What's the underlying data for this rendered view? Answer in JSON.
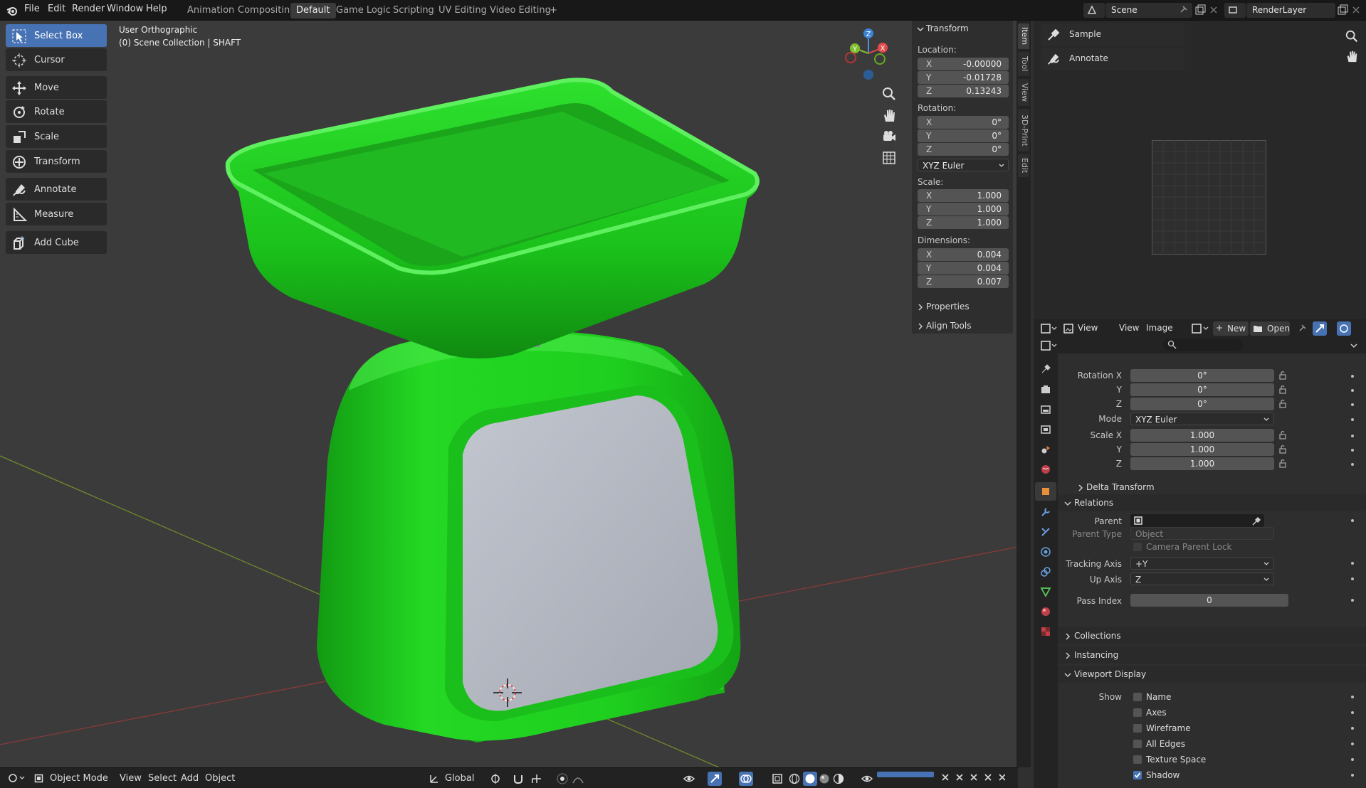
{
  "topbar": {
    "menus": [
      "File",
      "Edit",
      "Render",
      "Window",
      "Help"
    ],
    "workspaces": [
      "Animation",
      "Compositing",
      "Default",
      "Game Logic",
      "Scripting",
      "UV Editing",
      "Video Editing"
    ],
    "active_workspace": "Default",
    "add_tab": "+",
    "scene": "Scene",
    "view_layer": "RenderLayer"
  },
  "viewport": {
    "title": "User Orthographic",
    "subtitle": "(0) Scene Collection | SHAFT",
    "model_color": "#1fd41f"
  },
  "toolbar": {
    "tools": [
      "Select Box",
      "Cursor",
      "Move",
      "Rotate",
      "Scale",
      "Transform",
      "Annotate",
      "Measure",
      "Add Cube"
    ]
  },
  "gizmo": {
    "z": "Z",
    "y": "Y",
    "x": "X"
  },
  "npanel": {
    "header": "Transform",
    "location_label": "Location:",
    "location": {
      "x": "-0.00000",
      "y": "-0.01728",
      "z": "0.13243"
    },
    "rotation_label": "Rotation:",
    "rotation": {
      "x": "0°",
      "y": "0°",
      "z": "0°"
    },
    "rotation_mode": "XYZ Euler",
    "scale_label": "Scale:",
    "scale": {
      "x": "1.000",
      "y": "1.000",
      "z": "1.000"
    },
    "dimensions_label": "Dimensions:",
    "dimensions": {
      "x": "0.004",
      "y": "0.004",
      "z": "0.007"
    },
    "axis": {
      "x": "X",
      "y": "Y",
      "z": "Z"
    },
    "properties": "Properties",
    "align_tools": "Align Tools"
  },
  "sidebar_tabs": [
    "Item",
    "Tool",
    "View",
    "3D-Print",
    "Edit"
  ],
  "viewport_footer": {
    "mode": "Object Mode",
    "menus": [
      "View",
      "Select",
      "Add",
      "Object"
    ],
    "orientation": "Global"
  },
  "image_editor": {
    "tools": [
      "Sample",
      "Annotate"
    ],
    "header": {
      "view": "View",
      "menu_view": "View",
      "image": "Image",
      "new": "New",
      "open": "Open"
    }
  },
  "properties": {
    "rotation_x_label": "Rotation X",
    "rotation": {
      "x": "0°",
      "y": "0°",
      "z": "0°"
    },
    "y_label": "Y",
    "z_label": "Z",
    "mode_label": "Mode",
    "mode": "XYZ Euler",
    "scale_x_label": "Scale X",
    "scale": {
      "x": "1.000",
      "y": "1.000",
      "z": "1.000"
    },
    "delta_transform": "Delta Transform",
    "relations": "Relations",
    "parent_label": "Parent",
    "parent_type_label": "Parent Type",
    "parent_type": "Object",
    "camera_parent_lock": "Camera Parent Lock",
    "tracking_axis_label": "Tracking Axis",
    "tracking_axis": "+Y",
    "up_axis_label": "Up Axis",
    "up_axis": "Z",
    "pass_index_label": "Pass Index",
    "pass_index": "0",
    "collections": "Collections",
    "instancing": "Instancing",
    "viewport_display": "Viewport Display",
    "show_label": "Show",
    "show": [
      {
        "label": "Name",
        "checked": false
      },
      {
        "label": "Axes",
        "checked": false
      },
      {
        "label": "Wireframe",
        "checked": false
      },
      {
        "label": "All Edges",
        "checked": false
      },
      {
        "label": "Texture Space",
        "checked": false
      },
      {
        "label": "Shadow",
        "checked": true
      }
    ]
  }
}
